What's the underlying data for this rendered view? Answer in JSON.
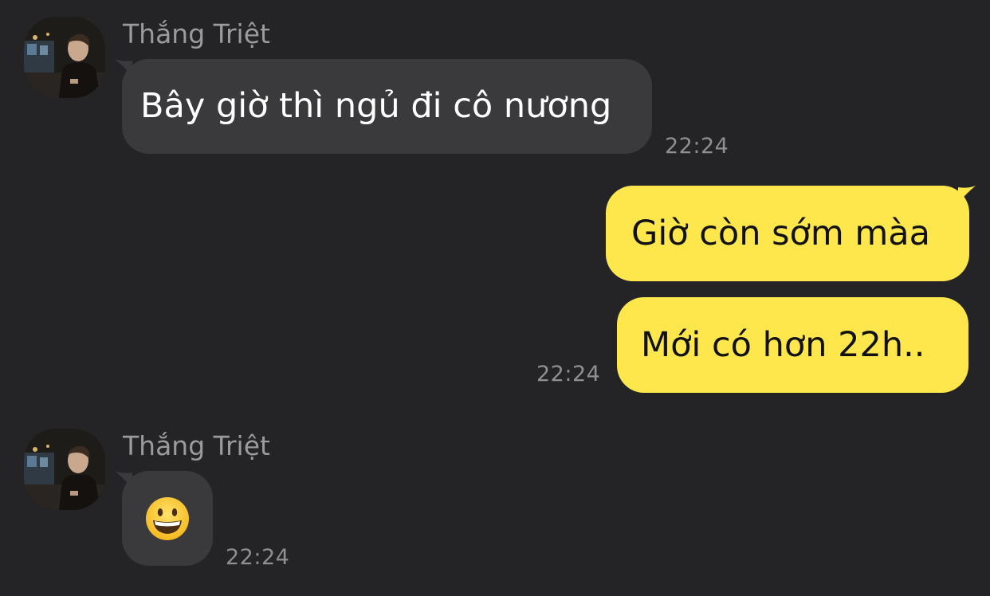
{
  "messages": [
    {
      "sender": "Thắng Triệt",
      "text": "Bây giờ thì ngủ đi cô nương",
      "time": "22:24"
    },
    {
      "text": "Giờ còn sớm màa"
    },
    {
      "text": "Mới có hơn 22h..",
      "time": "22:24"
    },
    {
      "sender": "Thắng Triệt",
      "emoji": "grinning-face",
      "time": "22:24"
    }
  ],
  "colors": {
    "background": "#242426",
    "incoming_bubble": "#3a3a3c",
    "outgoing_bubble": "#fde74c",
    "name_text": "#9a9a9f",
    "time_text": "#8e8e93"
  }
}
